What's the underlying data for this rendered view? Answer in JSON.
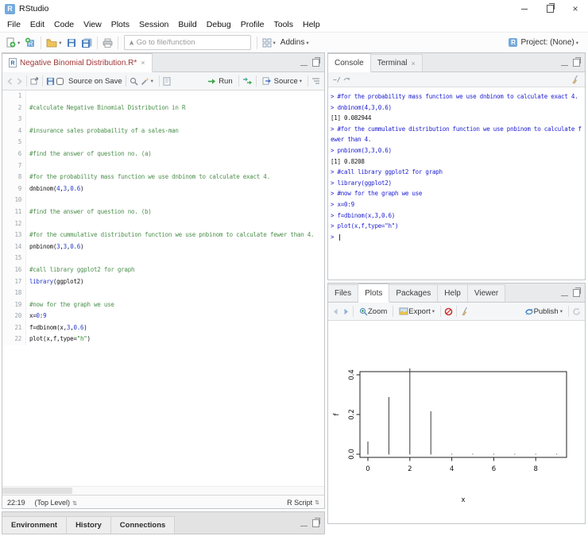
{
  "glyphs": {
    "caret": "▾",
    "close": "×",
    "updown": "⇅"
  },
  "window": {
    "title": "RStudio"
  },
  "menu_bar": {
    "items": [
      "File",
      "Edit",
      "Code",
      "View",
      "Plots",
      "Session",
      "Build",
      "Debug",
      "Profile",
      "Tools",
      "Help"
    ]
  },
  "toolbar": {
    "goto_placeholder": "Go to file/function",
    "addins_label": "Addins",
    "project_label": "Project: (None)"
  },
  "source_pane": {
    "tab_title": "Negative Binomial Distribution.R*",
    "toolbar": {
      "source_on_save": "Source on Save",
      "run_label": "Run",
      "source_label": "Source"
    },
    "code_lines": [
      {
        "n": 1,
        "segs": []
      },
      {
        "n": 2,
        "segs": [
          {
            "c": "com",
            "t": "#calculate Negative Binomial Distribution in R"
          }
        ]
      },
      {
        "n": 3,
        "segs": []
      },
      {
        "n": 4,
        "segs": [
          {
            "c": "com",
            "t": "#insurance sales probabaility of a sales-man"
          }
        ]
      },
      {
        "n": 5,
        "segs": []
      },
      {
        "n": 6,
        "segs": [
          {
            "c": "com",
            "t": "#find the answer of question no. (a)"
          }
        ]
      },
      {
        "n": 7,
        "segs": []
      },
      {
        "n": 8,
        "segs": [
          {
            "c": "com",
            "t": "#for the probability mass function we use dnbinom to calculate exact 4."
          }
        ]
      },
      {
        "n": 9,
        "segs": [
          {
            "t": "dnbinom("
          },
          {
            "c": "num",
            "t": "4"
          },
          {
            "t": ","
          },
          {
            "c": "num",
            "t": "3"
          },
          {
            "t": ","
          },
          {
            "c": "num",
            "t": "0.6"
          },
          {
            "t": ")"
          }
        ]
      },
      {
        "n": 10,
        "segs": []
      },
      {
        "n": 11,
        "segs": [
          {
            "c": "com",
            "t": "#find the answer of question no. (b)"
          }
        ]
      },
      {
        "n": 12,
        "segs": []
      },
      {
        "n": 13,
        "segs": [
          {
            "c": "com",
            "t": "#for the cummulative distribution function we use pnbinom to calculate fewer than 4."
          }
        ]
      },
      {
        "n": 14,
        "segs": [
          {
            "t": "pnbinom("
          },
          {
            "c": "num",
            "t": "3"
          },
          {
            "t": ","
          },
          {
            "c": "num",
            "t": "3"
          },
          {
            "t": ","
          },
          {
            "c": "num",
            "t": "0.6"
          },
          {
            "t": ")"
          }
        ]
      },
      {
        "n": 15,
        "segs": []
      },
      {
        "n": 16,
        "segs": [
          {
            "c": "com",
            "t": "#call library ggplot2 for graph"
          }
        ]
      },
      {
        "n": 17,
        "segs": [
          {
            "c": "kw",
            "t": "library"
          },
          {
            "t": "(ggplot2)"
          }
        ]
      },
      {
        "n": 18,
        "segs": []
      },
      {
        "n": 19,
        "segs": [
          {
            "c": "com",
            "t": "#now for the graph we use"
          }
        ]
      },
      {
        "n": 20,
        "segs": [
          {
            "t": "x="
          },
          {
            "c": "num",
            "t": "0"
          },
          {
            "t": ":"
          },
          {
            "c": "num",
            "t": "9"
          }
        ]
      },
      {
        "n": 21,
        "segs": [
          {
            "t": "f=dbinom(x,"
          },
          {
            "c": "num",
            "t": "3"
          },
          {
            "t": ","
          },
          {
            "c": "num",
            "t": "0.6"
          },
          {
            "t": ")"
          }
        ]
      },
      {
        "n": 22,
        "segs": [
          {
            "t": "plot(x,f,type="
          },
          {
            "c": "str",
            "t": "\"h\""
          },
          {
            "t": ")"
          }
        ]
      }
    ],
    "status_bar": {
      "position": "22:19",
      "scope": "(Top Level)",
      "file_type": "R Script"
    }
  },
  "console_pane": {
    "tabs": [
      {
        "label": "Console",
        "active": true,
        "closable": false
      },
      {
        "label": "Terminal",
        "active": false,
        "closable": true
      }
    ],
    "path": "~/",
    "lines": [
      {
        "kind": "input",
        "text": "> #for the probability mass function we use dnbinom to calculate exact 4."
      },
      {
        "kind": "input",
        "text": "> dnbinom(4,3,0.6)"
      },
      {
        "kind": "output",
        "text": "[1] 0.082944"
      },
      {
        "kind": "input",
        "text": "> #for the cummulative distribution function we use pnbinom to calculate f"
      },
      {
        "kind": "input",
        "text": "ewer than 4."
      },
      {
        "kind": "input",
        "text": "> pnbinom(3,3,0.6)"
      },
      {
        "kind": "output",
        "text": "[1] 0.8208"
      },
      {
        "kind": "input",
        "text": "> #call library ggplot2 for graph"
      },
      {
        "kind": "input",
        "text": "> library(ggplot2)"
      },
      {
        "kind": "input",
        "text": "> #now for the graph we use"
      },
      {
        "kind": "input",
        "text": "> x=0:9"
      },
      {
        "kind": "input",
        "text": "> f=dbinom(x,3,0.6)"
      },
      {
        "kind": "input",
        "text": "> plot(x,f,type=\"h\")"
      },
      {
        "kind": "prompt",
        "text": "> "
      }
    ]
  },
  "env_pane": {
    "tabs": [
      "Environment",
      "History",
      "Connections"
    ]
  },
  "plots_pane": {
    "tabs": [
      "Files",
      "Plots",
      "Packages",
      "Help",
      "Viewer"
    ],
    "active_tab": "Plots",
    "toolbar": {
      "zoom_label": "Zoom",
      "export_label": "Export",
      "publish_label": "Publish"
    }
  },
  "chart_data": {
    "type": "bar",
    "style": "R base graphics plot(x, f, type='h') — vertical line spikes",
    "title": "",
    "x": [
      0,
      1,
      2,
      3,
      4,
      5,
      6,
      7,
      8,
      9
    ],
    "values": [
      0.064,
      0.288,
      0.432,
      0.216,
      0,
      0,
      0,
      0,
      0,
      0
    ],
    "series_name": "f = dbinom(x, 3, 0.6)",
    "xlabel": "x",
    "ylabel": "f",
    "x_ticks": [
      0,
      2,
      4,
      6,
      8
    ],
    "y_ticks": [
      0,
      0.2,
      0.4
    ],
    "y_tick_labels": [
      "0.0",
      "0.2",
      "0.4"
    ],
    "xlim": [
      0,
      9
    ],
    "ylim": [
      0,
      0.432
    ],
    "grid": false,
    "legend": "none",
    "line_color": "#3a3a3a"
  }
}
